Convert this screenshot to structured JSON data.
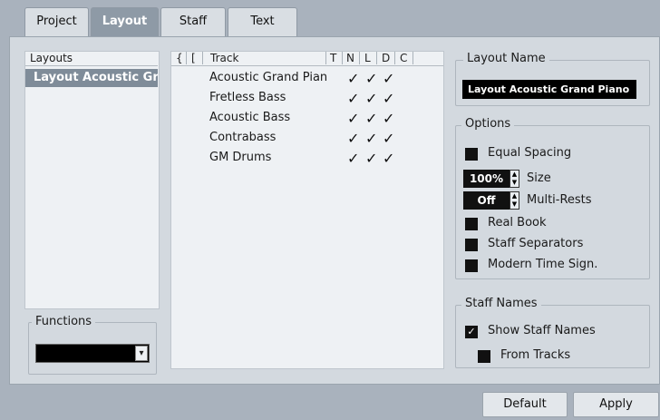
{
  "tabs": [
    "Project",
    "Layout",
    "Staff",
    "Text"
  ],
  "layouts": {
    "header": "Layouts",
    "items": [
      "Layout Acoustic Gra"
    ]
  },
  "functions": {
    "title": "Functions",
    "selected": ""
  },
  "tracks": {
    "columns": [
      "{",
      "[",
      "Track",
      "T",
      "N",
      "L",
      "D",
      "C"
    ],
    "rows": [
      {
        "name": "Acoustic Grand Pian",
        "check": "✓"
      },
      {
        "name": "Fretless Bass",
        "check": "✓"
      },
      {
        "name": "Acoustic Bass",
        "check": "✓"
      },
      {
        "name": "Contrabass",
        "check": "✓"
      },
      {
        "name": "GM Drums",
        "check": "✓"
      }
    ]
  },
  "layout_name": {
    "title": "Layout Name",
    "value": "Layout Acoustic Grand Piano"
  },
  "options": {
    "title": "Options",
    "equal_spacing": "Equal Spacing",
    "size_value": "100%",
    "size_label": "Size",
    "multirests_value": "Off",
    "multirests_label": "Multi-Rests",
    "real_book": "Real Book",
    "staff_separators": "Staff Separators",
    "modern_time": "Modern Time Sign."
  },
  "staff_names": {
    "title": "Staff Names",
    "show": "Show Staff Names",
    "from_tracks": "From Tracks"
  },
  "buttons": {
    "default": "Default",
    "apply": "Apply"
  },
  "icons": {
    "checkbox_checked": "✓",
    "dropdown": "▾"
  },
  "colors": {
    "background": "#a9b2bd",
    "panel": "#d3d9df",
    "selection": "#7f8c99"
  }
}
